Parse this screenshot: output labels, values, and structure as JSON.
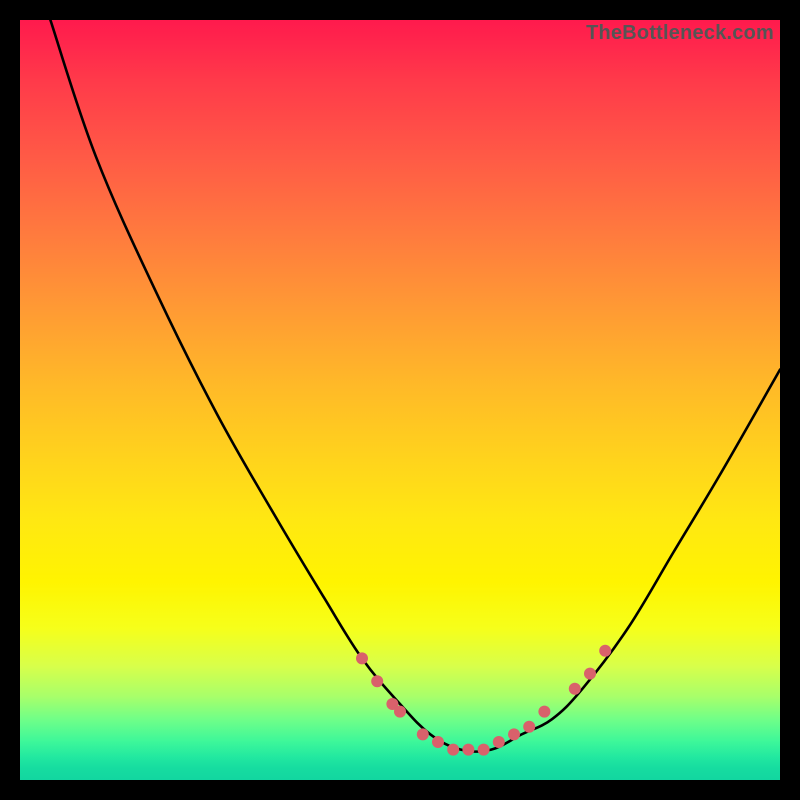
{
  "watermark": "TheBottleneck.com",
  "chart_data": {
    "type": "line",
    "title": "",
    "xlabel": "",
    "ylabel": "",
    "xlim": [
      0,
      100
    ],
    "ylim": [
      0,
      100
    ],
    "series": [
      {
        "name": "bottleneck-curve",
        "x": [
          4,
          10,
          18,
          26,
          34,
          40,
          45,
          50,
          54,
          58,
          62,
          66,
          70,
          74,
          80,
          86,
          92,
          100
        ],
        "y": [
          100,
          82,
          64,
          48,
          34,
          24,
          16,
          10,
          6,
          4,
          4,
          6,
          8,
          12,
          20,
          30,
          40,
          54
        ]
      }
    ],
    "markers": {
      "name": "highlight-dots",
      "color": "#d9616b",
      "points": [
        {
          "x": 45,
          "y": 16
        },
        {
          "x": 47,
          "y": 13
        },
        {
          "x": 49,
          "y": 10
        },
        {
          "x": 50,
          "y": 9
        },
        {
          "x": 53,
          "y": 6
        },
        {
          "x": 55,
          "y": 5
        },
        {
          "x": 57,
          "y": 4
        },
        {
          "x": 59,
          "y": 4
        },
        {
          "x": 61,
          "y": 4
        },
        {
          "x": 63,
          "y": 5
        },
        {
          "x": 65,
          "y": 6
        },
        {
          "x": 67,
          "y": 7
        },
        {
          "x": 69,
          "y": 9
        },
        {
          "x": 73,
          "y": 12
        },
        {
          "x": 75,
          "y": 14
        },
        {
          "x": 77,
          "y": 17
        }
      ]
    }
  }
}
